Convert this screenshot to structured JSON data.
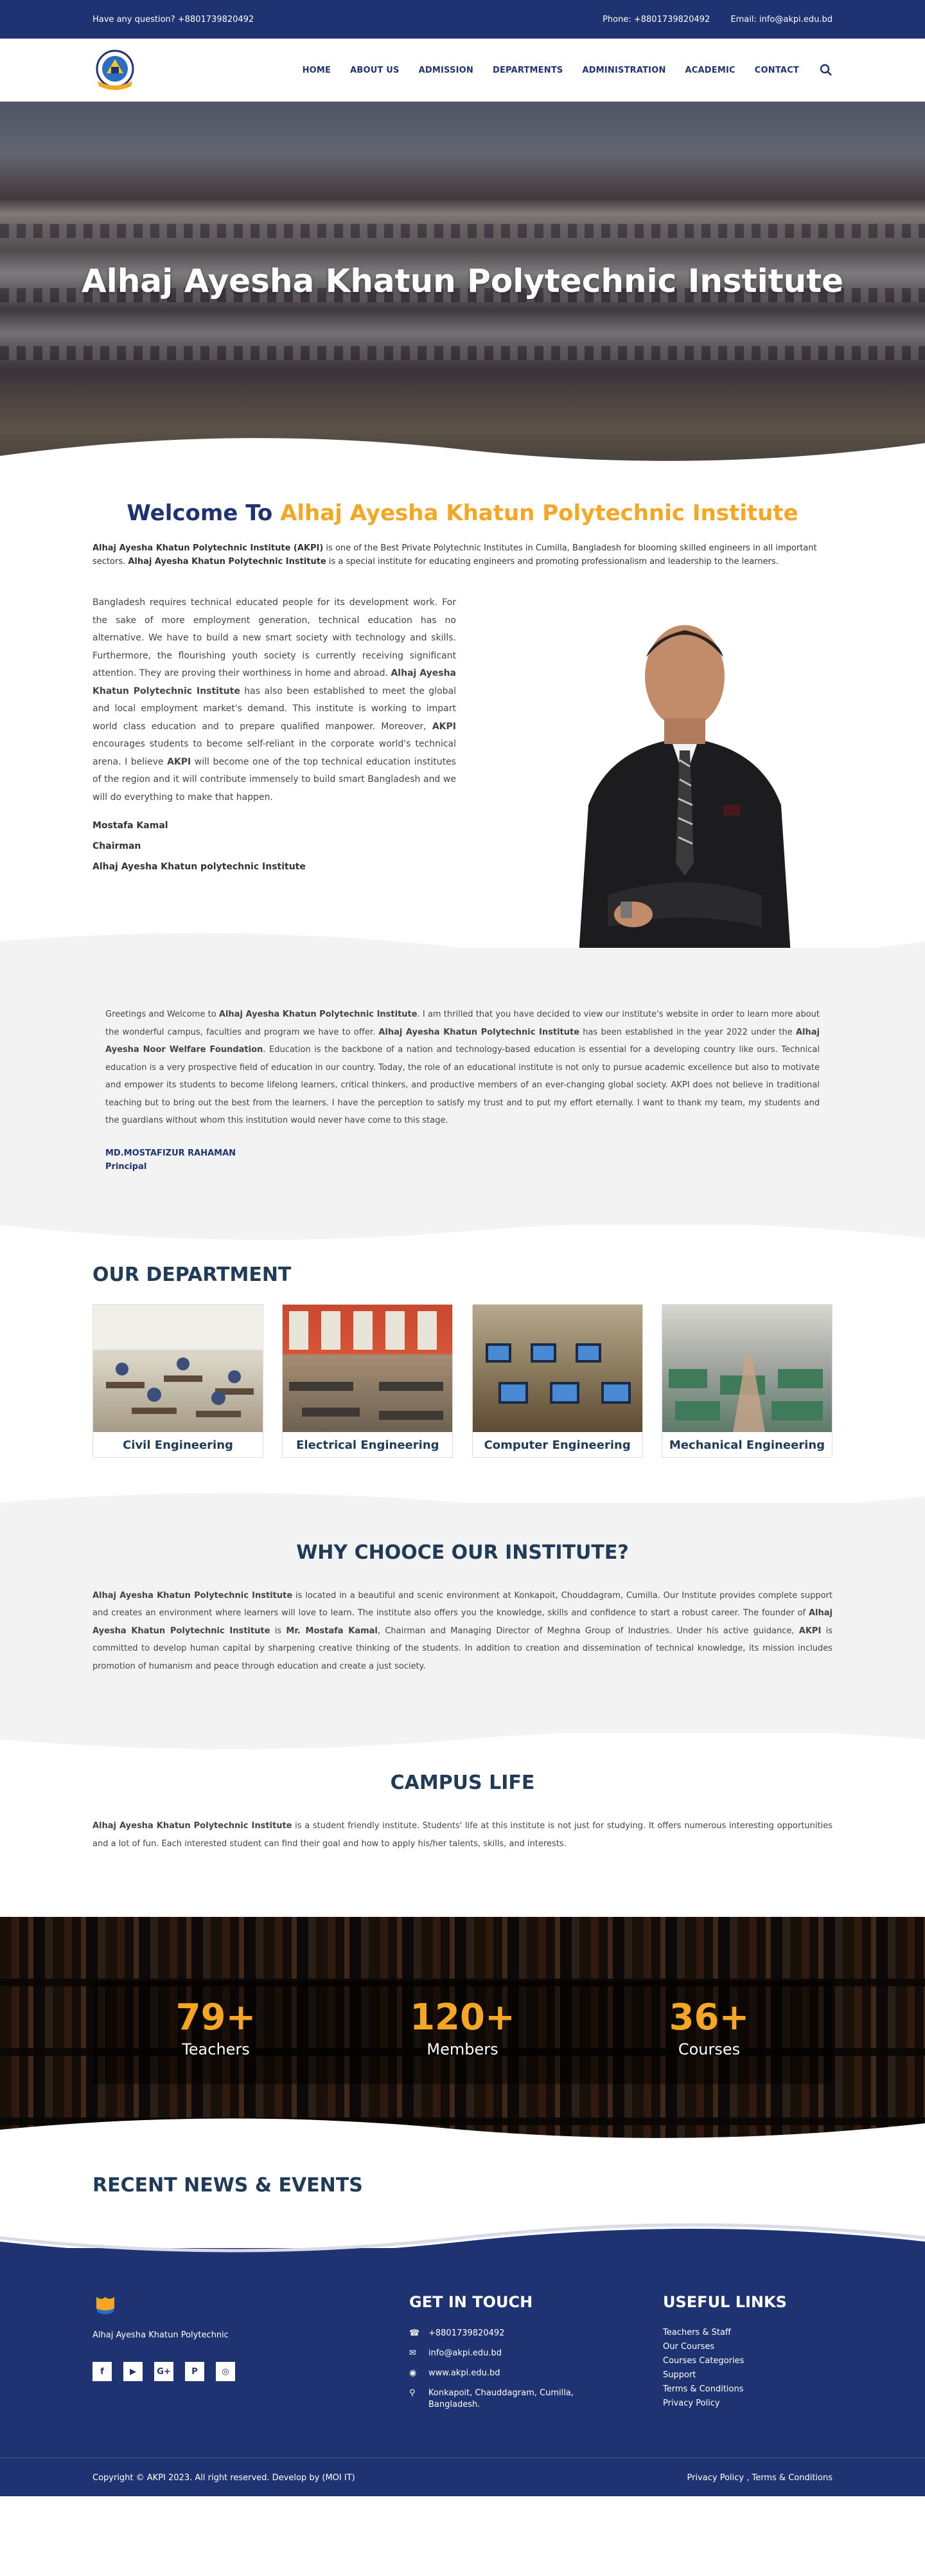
{
  "topbar": {
    "question": "Have any question? +8801739820492",
    "phone": "Phone: +8801739820492",
    "email": "Email: info@akpi.edu.bd"
  },
  "nav": {
    "items": [
      "HOME",
      "ABOUT US",
      "ADMISSION",
      "DEPARTMENTS",
      "ADMINISTRATION",
      "ACADEMIC",
      "CONTACT"
    ],
    "search_icon": "search-icon"
  },
  "hero": {
    "title": "Alhaj Ayesha Khatun Polytechnic Institute"
  },
  "welcome": {
    "title_prefix": "Welcome To ",
    "title_accent": "Alhaj Ayesha Khatun Polytechnic Institute",
    "intro_b1": "Alhaj Ayesha Khatun Polytechnic Institute (AKPI)",
    "intro_t1": " is one of the Best Private Polytechnic Institutes in Cumilla, Bangladesh for blooming skilled engineers in all important sectors. ",
    "intro_b2": "Alhaj Ayesha Khatun Polytechnic Institute",
    "intro_t2": " is a special institute for educating engineers and promoting professionalism and leadership to the learners."
  },
  "chairman": {
    "t1": "Bangladesh requires technical educated people for its development work. For the sake of more employment generation, technical education has no alternative. We have to build a new smart society with technology and skills. Furthermore, the flourishing youth society is currently receiving significant attention. They are proving their worthiness in home and abroad. ",
    "b1": "Alhaj Ayesha Khatun Polytechnic Institute",
    "t2": " has also been established to meet the global and local employment market's demand. This institute is working to impart world class education and to prepare qualified manpower. Moreover, ",
    "b2": "AKPI",
    "t3": " encourages students to become self-reliant in the corporate world's technical arena. I believe ",
    "b3": "AKPI",
    "t4": " will become one of the top technical education institutes of the region and it will contribute immensely to build smart Bangladesh and we will do everything to make that happen.",
    "name": "Mostafa Kamal",
    "role": "Chairman",
    "org": "Alhaj Ayesha Khatun polytechnic Institute"
  },
  "principal": {
    "t1": "Greetings and Welcome to ",
    "b1": "Alhaj Ayesha Khatun Polytechnic Institute",
    "t2": ". I am thrilled that you have decided to view our institute's website in order to learn more about the wonderful campus, faculties and program we have to offer. ",
    "b2": "Alhaj Ayesha Khatun Polytechnic Institute",
    "t3": " has been established in the year 2022 under the ",
    "b3": "Alhaj Ayesha Noor Welfare Foundation",
    "t4": ". Education is the backbone of a nation and technology-based education is essential for a developing country like ours. Technical education is a very prospective field of education in our country. Today, the role of an educational institute is not only to pursue academic excellence but also to motivate and empower its students to become lifelong learners, critical thinkers, and productive members of an ever-changing global society. AKPI does not believe in traditional teaching but to bring out the best from the learners. I have the perception to satisfy my trust and to put my effort eternally. I want to thank my team, my students and the guardians without whom this institution would never have come to this stage.",
    "name": "MD.MOSTAFIZUR RAHAMAN",
    "role": "Principal"
  },
  "departments": {
    "title": "OUR DEPARTMENT",
    "items": [
      "Civil Engineering",
      "Electrical Engineering",
      "Computer Engineering",
      "Mechanical Engineering"
    ]
  },
  "why": {
    "title": "WHY CHOOCE OUR INSTITUTE?",
    "b1": "Alhaj Ayesha Khatun Polytechnic Institute",
    "t1": " is located in a beautiful and scenic environment at Konkapoit, Chouddagram, Cumilla. Our Institute provides complete support and creates an environment where learners will love to learn. The institute also offers you the knowledge, skills and confidence to start a robust career. The founder of ",
    "b2": "Alhaj Ayesha Khatun Polytechnic Institute",
    "t2": " is ",
    "b3": "Mr. Mostafa Kamal",
    "t3": ", Chairman and Managing Director of Meghna Group of Industries. Under his active guidance, ",
    "b4": "AKPI",
    "t4": " is committed to develop human capital by sharpening creative thinking of the students. In addition to creation and dissemination of technical knowledge, its mission includes promotion of humanism and peace through education and create a just society."
  },
  "campus": {
    "title": "CAMPUS LIFE",
    "b1": "Alhaj Ayesha Khatun Polytechnic Institute",
    "t1": " is a student friendly institute. Students' life at this institute is not just for studying. It offers numerous interesting opportunities and a lot of fun. Each interested student can find their goal and how to apply his/her talents, skills, and interests."
  },
  "counters": [
    {
      "num": "79+",
      "label": "Teachers"
    },
    {
      "num": "120+",
      "label": "Members"
    },
    {
      "num": "36+",
      "label": "Courses"
    }
  ],
  "news": {
    "title": "RECENT NEWS & EVENTS"
  },
  "footer": {
    "brand": "Alhaj Ayesha Khatun Polytechnic",
    "socials": [
      "f",
      "▶",
      "G+",
      "P",
      "◎"
    ],
    "contact_title": "GET IN TOUCH",
    "phone": "+8801739820492",
    "email": "info@akpi.edu.bd",
    "web": "www.akpi.edu.bd",
    "address": "Konkapoit, Chauddagram, Cumilla, Bangladesh.",
    "links_title": "USEFUL LINKS",
    "links": [
      "Teachers & Staff",
      "Our Courses",
      "Courses Categories",
      "Support",
      "Terms & Conditions",
      "Privacy Policy"
    ],
    "copyright": "Copyright © AKPI 2023. All right reserved. Develop by (MOI IT)",
    "policy": "Privacy Policy , Terms & Conditions"
  },
  "colors": {
    "primary": "#1f3372",
    "accent": "#f5a623",
    "heading": "#1f3b57"
  }
}
